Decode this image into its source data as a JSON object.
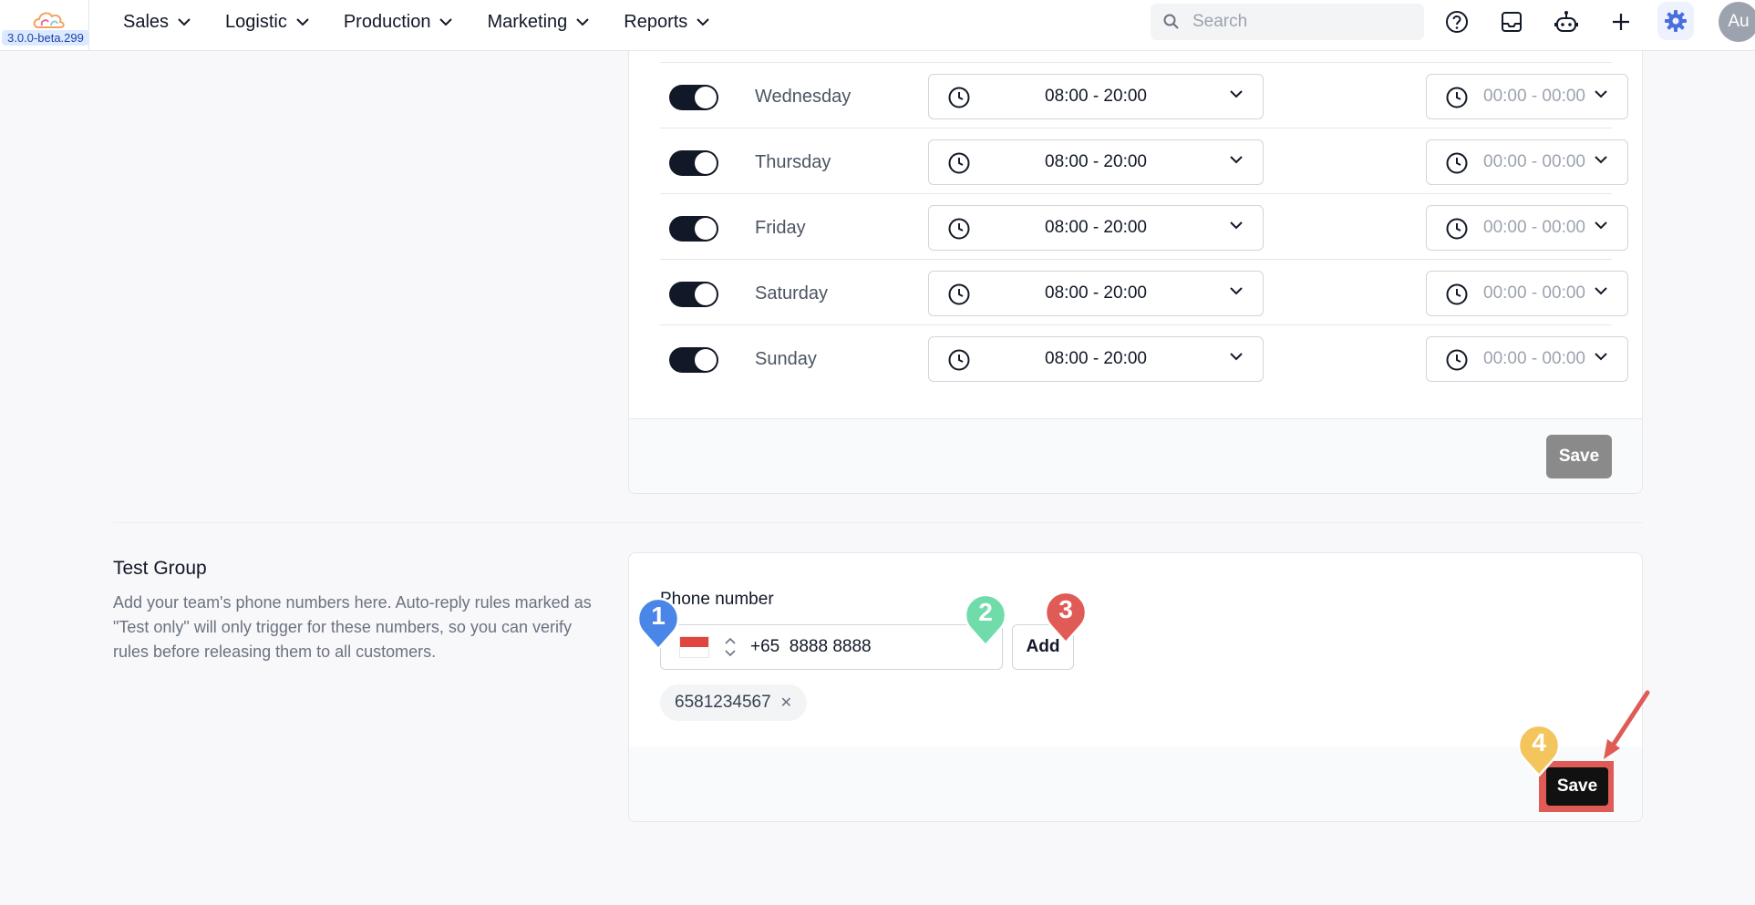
{
  "app": {
    "version": "3.0.0-beta.299",
    "avatar_initials": "Au"
  },
  "nav": {
    "items": [
      {
        "label": "Sales"
      },
      {
        "label": "Logistic"
      },
      {
        "label": "Production"
      },
      {
        "label": "Marketing"
      },
      {
        "label": "Reports"
      }
    ]
  },
  "search": {
    "placeholder": "Search"
  },
  "hours": {
    "days": [
      {
        "label": "Wednesday",
        "enabled": true,
        "time": "08:00 - 20:00",
        "alt_time": "00:00 - 00:00"
      },
      {
        "label": "Thursday",
        "enabled": true,
        "time": "08:00 - 20:00",
        "alt_time": "00:00 - 00:00"
      },
      {
        "label": "Friday",
        "enabled": true,
        "time": "08:00 - 20:00",
        "alt_time": "00:00 - 00:00"
      },
      {
        "label": "Saturday",
        "enabled": true,
        "time": "08:00 - 20:00",
        "alt_time": "00:00 - 00:00"
      },
      {
        "label": "Sunday",
        "enabled": true,
        "time": "08:00 - 20:00",
        "alt_time": "00:00 - 00:00"
      }
    ],
    "save_label": "Save"
  },
  "test_group": {
    "title": "Test Group",
    "description": "Add your team's phone numbers here. Auto-reply rules marked as \"Test only\" will only trigger for these numbers, so you can verify rules before releasing them to all customers.",
    "phone_label": "Phone number",
    "country_code": "+65",
    "phone_value": "8888 8888",
    "add_label": "Add",
    "numbers": [
      "6581234567"
    ],
    "save_label": "Save"
  },
  "markers": [
    {
      "num": "1",
      "color": "#4a86e8"
    },
    {
      "num": "2",
      "color": "#6fdcaa"
    },
    {
      "num": "3",
      "color": "#e05a56"
    },
    {
      "num": "4",
      "color": "#f4c55c"
    }
  ],
  "colors": {
    "accent": "#4a6fdc",
    "toggle_on": "#111827",
    "highlight": "#e05a56"
  }
}
